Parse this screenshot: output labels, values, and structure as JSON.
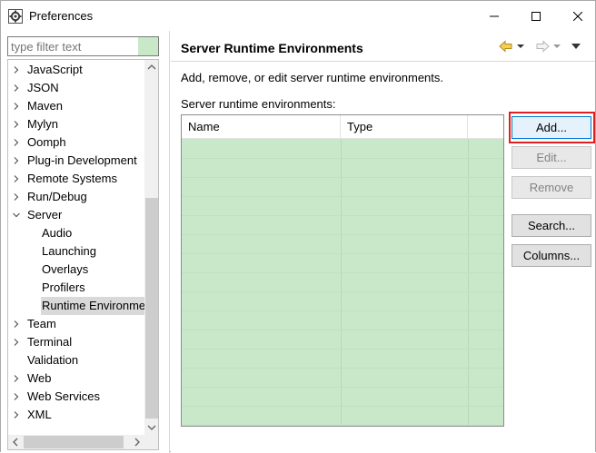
{
  "window": {
    "title": "Preferences",
    "icons": [
      "preferences-app-icon",
      "minimize-icon",
      "maximize-icon",
      "close-icon"
    ]
  },
  "sidebar": {
    "filter_placeholder": "type filter text",
    "items": [
      {
        "label": "JavaScript",
        "level": 0,
        "expander": "collapsed"
      },
      {
        "label": "JSON",
        "level": 0,
        "expander": "collapsed"
      },
      {
        "label": "Maven",
        "level": 0,
        "expander": "collapsed"
      },
      {
        "label": "Mylyn",
        "level": 0,
        "expander": "collapsed"
      },
      {
        "label": "Oomph",
        "level": 0,
        "expander": "collapsed"
      },
      {
        "label": "Plug-in Development",
        "level": 0,
        "expander": "collapsed"
      },
      {
        "label": "Remote Systems",
        "level": 0,
        "expander": "collapsed"
      },
      {
        "label": "Run/Debug",
        "level": 0,
        "expander": "collapsed"
      },
      {
        "label": "Server",
        "level": 0,
        "expander": "expanded"
      },
      {
        "label": "Audio",
        "level": 1,
        "expander": "none"
      },
      {
        "label": "Launching",
        "level": 1,
        "expander": "none"
      },
      {
        "label": "Overlays",
        "level": 1,
        "expander": "none"
      },
      {
        "label": "Profilers",
        "level": 1,
        "expander": "none"
      },
      {
        "label": "Runtime Environme",
        "level": 1,
        "expander": "none",
        "selected": true
      },
      {
        "label": "Team",
        "level": 0,
        "expander": "collapsed"
      },
      {
        "label": "Terminal",
        "level": 0,
        "expander": "collapsed"
      },
      {
        "label": "Validation",
        "level": 0,
        "expander": "none"
      },
      {
        "label": "Web",
        "level": 0,
        "expander": "collapsed"
      },
      {
        "label": "Web Services",
        "level": 0,
        "expander": "collapsed"
      },
      {
        "label": "XML",
        "level": 0,
        "expander": "collapsed"
      }
    ]
  },
  "main": {
    "title": "Server Runtime Environments",
    "description": "Add, remove, or edit server runtime environments.",
    "list_label": "Server runtime environments:",
    "table": {
      "columns": [
        "Name",
        "Type"
      ],
      "rows": []
    },
    "buttons": {
      "add": "Add...",
      "edit": "Edit...",
      "remove": "Remove",
      "search": "Search...",
      "columns": "Columns..."
    },
    "nav_icons": [
      "back-arrow-icon",
      "back-dropdown-icon",
      "forward-arrow-icon",
      "forward-dropdown-icon",
      "view-menu-icon"
    ]
  },
  "colors": {
    "table_background": "#c9e8c9",
    "highlight_border": "#e02020",
    "selection_background": "#d9d9d9",
    "back_arrow": "#e8b93a"
  }
}
